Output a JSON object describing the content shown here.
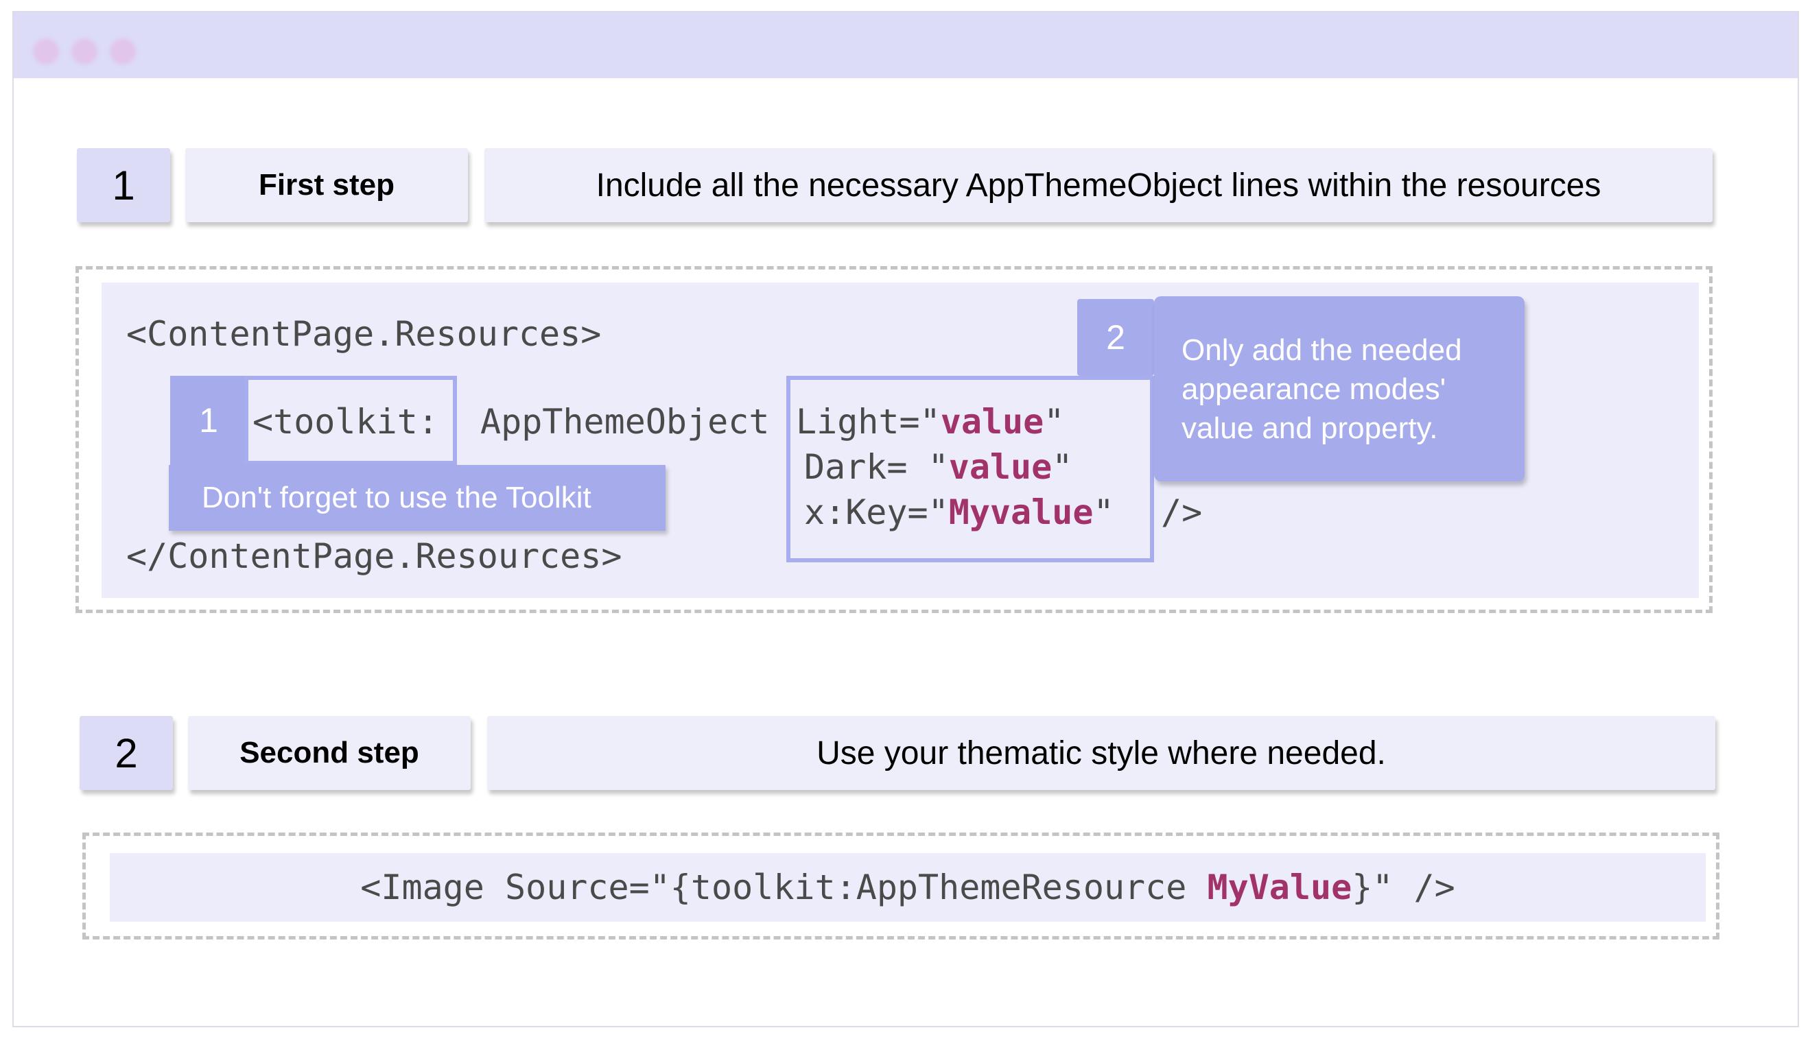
{
  "colors": {
    "titlebar": "#dcdcf7",
    "card": "#eeeefb",
    "number_card": "#dcdcf7",
    "code_background": "#ececfa",
    "badge": "#a6aceb",
    "highlight_outline": "#a8adee",
    "keyword": "#a1336a",
    "code_text": "#4a4a4a"
  },
  "window": {
    "controls": [
      "red-dot-icon",
      "yellow-dot-icon",
      "green-dot-icon"
    ]
  },
  "steps": [
    {
      "number": "1",
      "title": "First step",
      "description": "Include all the necessary AppThemeObject lines within the resources"
    },
    {
      "number": "2",
      "title": "Second step",
      "description": "Use your thematic style where needed."
    }
  ],
  "code1": {
    "open_tag": "<ContentPage.Resources>",
    "toolkit_prefix": "<toolkit:",
    "object_name": "AppThemeObject",
    "light_attr": "Light=\"",
    "light_value": "value",
    "light_close": "\"",
    "dark_attr": "Dark= \"",
    "dark_value": "value",
    "dark_close": "\"",
    "key_attr": "x:Key=\"",
    "key_value": "Myvalue",
    "key_close": "\"",
    "self_close": "/>",
    "close_tag": "</ContentPage.Resources>"
  },
  "annotations": {
    "badge1": "1",
    "callout1": "Don't forget to use the Toolkit",
    "badge2": "2",
    "callout2": "Only add the needed appearance modes' value and property."
  },
  "code2": {
    "prefix": "<Image Source=\"{toolkit:AppThemeResource ",
    "value": "MyValue",
    "suffix": "}\" />"
  }
}
